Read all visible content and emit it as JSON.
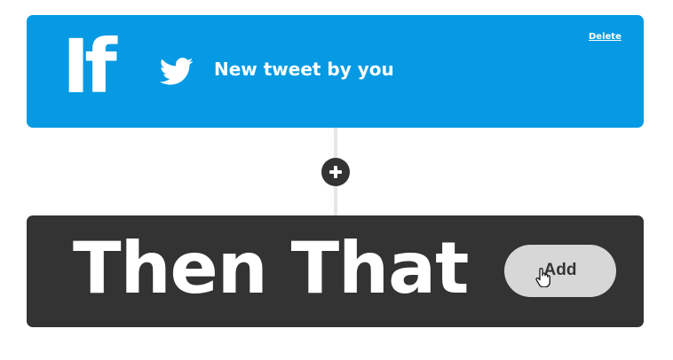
{
  "trigger_card": {
    "keyword": "If",
    "service_icon": "twitter-bird-icon",
    "trigger_label": "New tweet by you",
    "delete_label": "Delete",
    "color": "#059ae3"
  },
  "connector": {
    "add_step_icon": "plus-icon"
  },
  "action_card": {
    "keyword": "Then That",
    "add_label": "Add",
    "cursor_icon": "hand-pointer-icon",
    "color": "#333333",
    "button_color": "#d7d7d7"
  }
}
